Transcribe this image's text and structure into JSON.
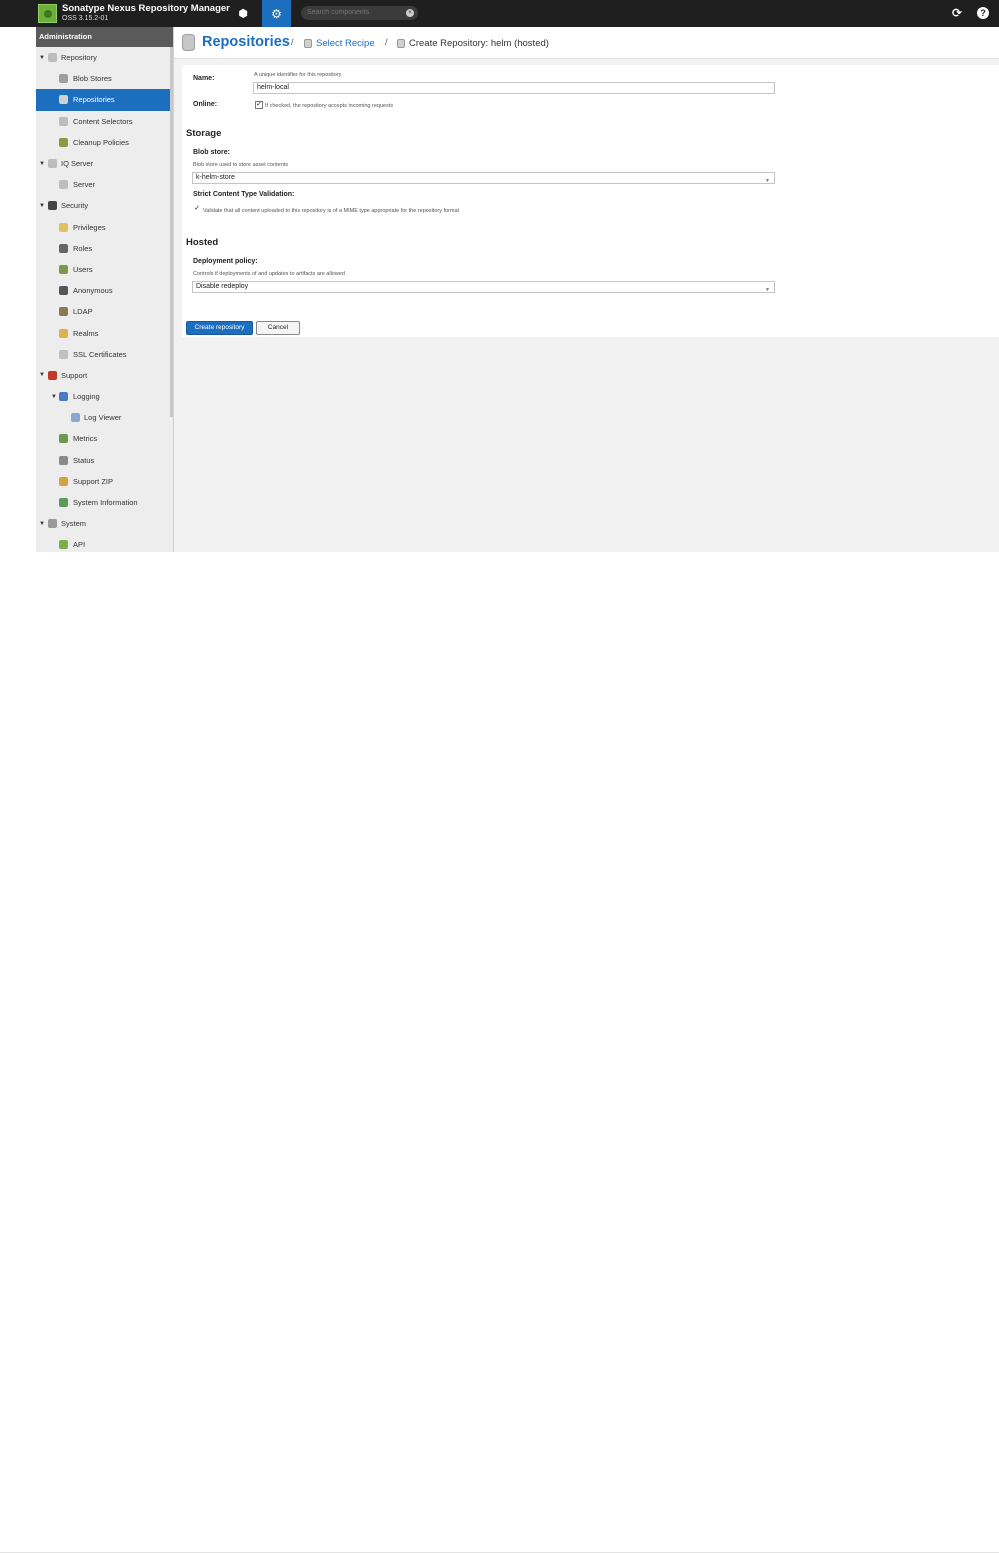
{
  "topbar": {
    "app_title": "Sonatype Nexus Repository Manager",
    "app_version": "OSS 3.15.2-01",
    "search_placeholder": "Search components"
  },
  "sidebar": {
    "header": "Administration",
    "items": [
      {
        "label": "Repository",
        "level": 0,
        "expanded": true,
        "icon": "database-icon",
        "color": "#bdbdbd"
      },
      {
        "label": "Blob Stores",
        "level": 1,
        "icon": "blob-store-icon",
        "color": "#9e9e9e"
      },
      {
        "label": "Repositories",
        "level": 1,
        "icon": "database-icon",
        "color": "#d0d0d0",
        "active": true
      },
      {
        "label": "Content Selectors",
        "level": 1,
        "icon": "selector-icon",
        "color": "#bdbdbd"
      },
      {
        "label": "Cleanup Policies",
        "level": 1,
        "icon": "broom-icon",
        "color": "#8d9a4a"
      },
      {
        "label": "IQ Server",
        "level": 0,
        "expanded": true,
        "icon": "iq-icon",
        "color": "#bdbdbd"
      },
      {
        "label": "Server",
        "level": 1,
        "icon": "server-icon",
        "color": "#bdbdbd"
      },
      {
        "label": "Security",
        "level": 0,
        "expanded": true,
        "icon": "security-icon",
        "color": "#444444"
      },
      {
        "label": "Privileges",
        "level": 1,
        "icon": "privileges-icon",
        "color": "#e0c060"
      },
      {
        "label": "Roles",
        "level": 1,
        "icon": "roles-icon",
        "color": "#666666"
      },
      {
        "label": "Users",
        "level": 1,
        "icon": "users-icon",
        "color": "#7a9a4a"
      },
      {
        "label": "Anonymous",
        "level": 1,
        "icon": "anonymous-icon",
        "color": "#555555"
      },
      {
        "label": "LDAP",
        "level": 1,
        "icon": "ldap-icon",
        "color": "#8a7a50"
      },
      {
        "label": "Realms",
        "level": 1,
        "icon": "realms-icon",
        "color": "#e0b050"
      },
      {
        "label": "SSL Certificates",
        "level": 1,
        "icon": "certificate-icon",
        "color": "#c0c0c0"
      },
      {
        "label": "Support",
        "level": 0,
        "expanded": true,
        "icon": "support-icon",
        "color": "#c0392b"
      },
      {
        "label": "Logging",
        "level": 1,
        "expanded": true,
        "icon": "logging-icon",
        "color": "#4a7abf"
      },
      {
        "label": "Log Viewer",
        "level": 2,
        "icon": "log-viewer-icon",
        "color": "#8aa8d0"
      },
      {
        "label": "Metrics",
        "level": 1,
        "icon": "metrics-icon",
        "color": "#6a9a4a"
      },
      {
        "label": "Status",
        "level": 1,
        "icon": "status-icon",
        "color": "#8a8a8a"
      },
      {
        "label": "Support ZIP",
        "level": 1,
        "icon": "zip-icon",
        "color": "#d4a040"
      },
      {
        "label": "System Information",
        "level": 1,
        "icon": "system-info-icon",
        "color": "#5a9a5a"
      },
      {
        "label": "System",
        "level": 0,
        "expanded": true,
        "icon": "system-icon",
        "color": "#9a9a9a"
      },
      {
        "label": "API",
        "level": 1,
        "icon": "api-icon",
        "color": "#7ab04a"
      }
    ]
  },
  "breadcrumb": {
    "title": "Repositories",
    "recipe": "Select Recipe",
    "current": "Create Repository: helm (hosted)"
  },
  "form": {
    "name_label": "Name:",
    "name_help": "A unique identifier for this repository",
    "name_value": "helm-local",
    "online_label": "Online:",
    "online_help": "If checked, the repository accepts incoming requests",
    "storage_section": "Storage",
    "blob_label": "Blob store:",
    "blob_help": "Blob store used to store asset contents",
    "blob_value": "k-helm-store",
    "strict_label": "Strict Content Type Validation:",
    "strict_help": "Validate that all content uploaded to this repository is of a MIME type appropriate for the repository format",
    "hosted_section": "Hosted",
    "deploy_label": "Deployment policy:",
    "deploy_help": "Controls if deployments of and updates to artifacts are allowed",
    "deploy_value": "Disable redeploy",
    "create_button": "Create repository",
    "cancel_button": "Cancel"
  }
}
